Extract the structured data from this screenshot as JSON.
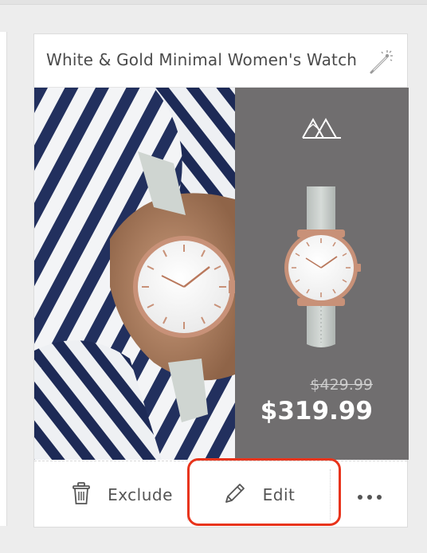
{
  "card": {
    "title": "White & Gold Minimal Women's Watch",
    "magic_icon": "magic-wand-icon"
  },
  "product": {
    "brand_icon": "mountain-logo-icon",
    "old_price": "$429.99",
    "new_price": "$319.99",
    "panel_color": "#706e6f"
  },
  "actions": {
    "exclude_label": "Exclude",
    "exclude_icon": "trash-icon",
    "edit_label": "Edit",
    "edit_icon": "pencil-icon",
    "more_icon": "more-dots-icon"
  },
  "colors": {
    "highlight": "#e8341c",
    "stripe_navy": "#1f2d5c",
    "watch_gold": "#c89178",
    "strap_gray": "#c9cfcb"
  }
}
